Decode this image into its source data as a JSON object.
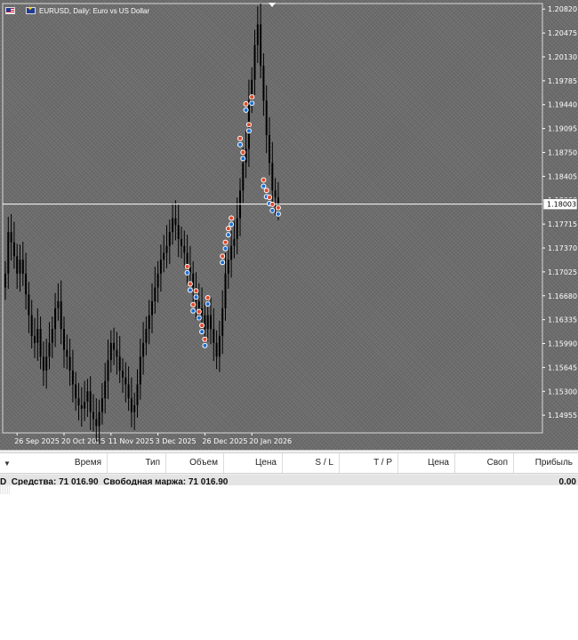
{
  "chart": {
    "symbol": "EURUSD",
    "timeframe": "Daily",
    "description": "Euro vs US Dollar",
    "header": "EURUSD, Daily:  Euro vs US Dollar",
    "current_price": "1.18003",
    "price_axis": [
      "1.20820",
      "1.20475",
      "1.20130",
      "1.19785",
      "1.19440",
      "1.19095",
      "1.18750",
      "1.18405",
      "1.18060",
      "1.17715",
      "1.17370",
      "1.17025",
      "1.16680",
      "1.16335",
      "1.15990",
      "1.15645",
      "1.15300",
      "1.14955"
    ],
    "time_axis": [
      "26 Sep 2025",
      "20 Oct 2025",
      "11 Nov 2025",
      "3 Dec 2025",
      "26 Dec 2025",
      "20 Jan 2026"
    ],
    "background_color": "#6e6e6e",
    "candle_color": "#000000",
    "bid_line_color": "#ffffff",
    "trade_marker_colors": {
      "buy": "#1e6fd0",
      "sell": "#e0482a"
    }
  },
  "chart_data": {
    "type": "candlestick",
    "title": "EURUSD, Daily:  Euro vs US Dollar",
    "ylim": [
      1.147,
      1.209
    ],
    "x": [
      "2025-09-22",
      "2025-09-23",
      "2025-09-24",
      "2025-09-25",
      "2025-09-26",
      "2025-09-29",
      "2025-09-30",
      "2025-10-01",
      "2025-10-02",
      "2025-10-03",
      "2025-10-06",
      "2025-10-07",
      "2025-10-08",
      "2025-10-09",
      "2025-10-10",
      "2025-10-13",
      "2025-10-14",
      "2025-10-15",
      "2025-10-16",
      "2025-10-17",
      "2025-10-20",
      "2025-10-21",
      "2025-10-22",
      "2025-10-23",
      "2025-10-24",
      "2025-10-27",
      "2025-10-28",
      "2025-10-29",
      "2025-10-30",
      "2025-10-31",
      "2025-11-03",
      "2025-11-04",
      "2025-11-05",
      "2025-11-06",
      "2025-11-07",
      "2025-11-10",
      "2025-11-11",
      "2025-11-12",
      "2025-11-13",
      "2025-11-14",
      "2025-11-17",
      "2025-11-18",
      "2025-11-19",
      "2025-11-20",
      "2025-11-21",
      "2025-11-24",
      "2025-11-25",
      "2025-11-26",
      "2025-11-27",
      "2025-11-28",
      "2025-12-01",
      "2025-12-02",
      "2025-12-03",
      "2025-12-04",
      "2025-12-05",
      "2025-12-08",
      "2025-12-09",
      "2025-12-10",
      "2025-12-11",
      "2025-12-12",
      "2025-12-15",
      "2025-12-16",
      "2025-12-17",
      "2025-12-18",
      "2025-12-19",
      "2025-12-22",
      "2025-12-23",
      "2025-12-24",
      "2025-12-26",
      "2025-12-29",
      "2025-12-30",
      "2025-12-31",
      "2026-01-02",
      "2026-01-05",
      "2026-01-06",
      "2026-01-07",
      "2026-01-08",
      "2026-01-09",
      "2026-01-12",
      "2026-01-13",
      "2026-01-14",
      "2026-01-15",
      "2026-01-16",
      "2026-01-19",
      "2026-01-20",
      "2026-01-21",
      "2026-01-22",
      "2026-01-23",
      "2026-01-26",
      "2026-01-27",
      "2026-01-28",
      "2026-01-29",
      "2026-01-30",
      "2026-02-02"
    ],
    "close": [
      1.17,
      1.176,
      1.1745,
      1.1725,
      1.17,
      1.172,
      1.17,
      1.167,
      1.164,
      1.161,
      1.16,
      1.162,
      1.158,
      1.156,
      1.158,
      1.16,
      1.162,
      1.165,
      1.166,
      1.162,
      1.159,
      1.158,
      1.156,
      1.154,
      1.152,
      1.151,
      1.1505,
      1.1515,
      1.153,
      1.15,
      1.149,
      1.148,
      1.15,
      1.152,
      1.1545,
      1.1575,
      1.16,
      1.159,
      1.158,
      1.156,
      1.155,
      1.154,
      1.152,
      1.15,
      1.151,
      1.154,
      1.158,
      1.16,
      1.162,
      1.164,
      1.166,
      1.168,
      1.17,
      1.172,
      1.173,
      1.174,
      1.176,
      1.178,
      1.177,
      1.175,
      1.174,
      1.173,
      1.171,
      1.17,
      1.168,
      1.166,
      1.165,
      1.164,
      1.162,
      1.164,
      1.162,
      1.16,
      1.158,
      1.161,
      1.165,
      1.17,
      1.172,
      1.174,
      1.175,
      1.178,
      1.182,
      1.186,
      1.188,
      1.195,
      1.198,
      1.203,
      1.206,
      1.2,
      1.195,
      1.19,
      1.186,
      1.182,
      1.181,
      1.1795
    ],
    "trades": [
      {
        "date": "2025-12-17",
        "price": 1.1705
      },
      {
        "date": "2025-12-18",
        "price": 1.168
      },
      {
        "date": "2025-12-19",
        "price": 1.165
      },
      {
        "date": "2025-12-22",
        "price": 1.167
      },
      {
        "date": "2025-12-23",
        "price": 1.164
      },
      {
        "date": "2025-12-24",
        "price": 1.162
      },
      {
        "date": "2025-12-26",
        "price": 1.16
      },
      {
        "date": "2025-12-29",
        "price": 1.166
      },
      {
        "date": "2026-01-06",
        "price": 1.172
      },
      {
        "date": "2026-01-07",
        "price": 1.174
      },
      {
        "date": "2026-01-08",
        "price": 1.176
      },
      {
        "date": "2026-01-09",
        "price": 1.1775
      },
      {
        "date": "2026-01-14",
        "price": 1.189
      },
      {
        "date": "2026-01-15",
        "price": 1.187
      },
      {
        "date": "2026-01-16",
        "price": 1.194
      },
      {
        "date": "2026-01-19",
        "price": 1.191
      },
      {
        "date": "2026-01-20",
        "price": 1.195
      },
      {
        "date": "2026-01-26",
        "price": 1.183
      },
      {
        "date": "2026-01-27",
        "price": 1.1815
      },
      {
        "date": "2026-01-28",
        "price": 1.1805
      },
      {
        "date": "2026-01-29",
        "price": 1.1795
      },
      {
        "date": "2026-02-02",
        "price": 1.179
      }
    ]
  },
  "toolbox": {
    "columns": [
      "Время",
      "Тип",
      "Объем",
      "Цена",
      "S / L",
      "T / P",
      "Цена",
      "Своп",
      "Прибыль"
    ],
    "balance_prefix": "D",
    "equity_label": "Средства:",
    "equity_value": "71 016.90",
    "free_margin_label": "Свободная маржа:",
    "free_margin_value": "71 016.90",
    "profit_total": "0.00"
  }
}
